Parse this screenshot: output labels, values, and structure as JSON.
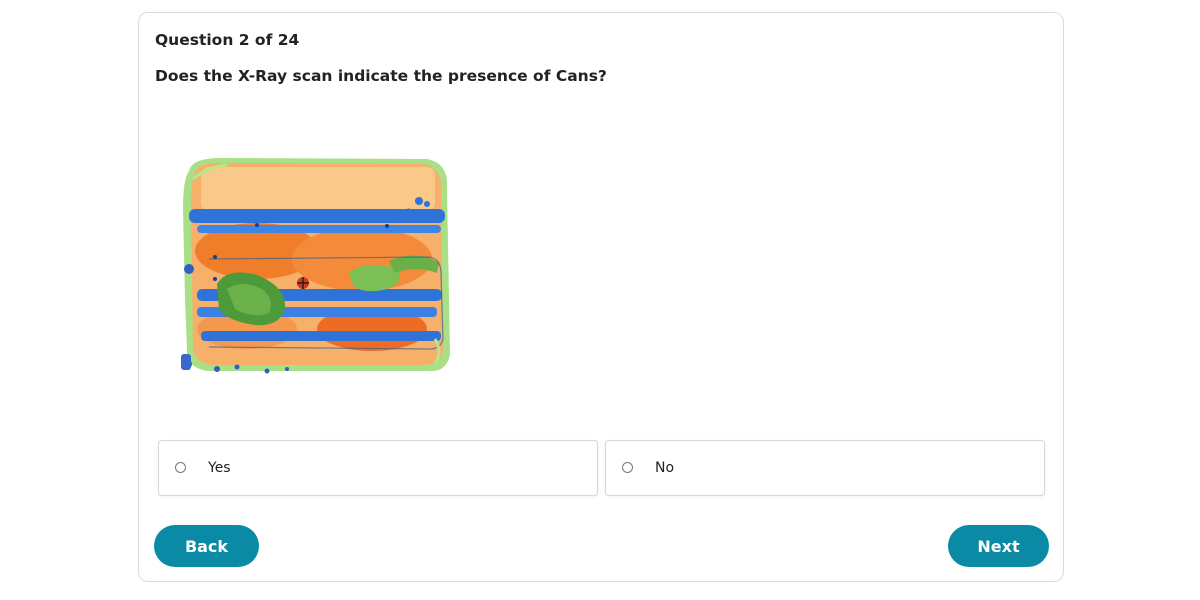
{
  "quiz": {
    "progress": "Question 2 of 24",
    "question": "Does the X-Ray scan indicate the presence of Cans?",
    "options": [
      {
        "label": "Yes",
        "selected": false
      },
      {
        "label": "No",
        "selected": false
      }
    ],
    "back_label": "Back",
    "next_label": "Next"
  },
  "colors": {
    "accent": "#0a8aa5",
    "border": "#dcdcdc"
  }
}
